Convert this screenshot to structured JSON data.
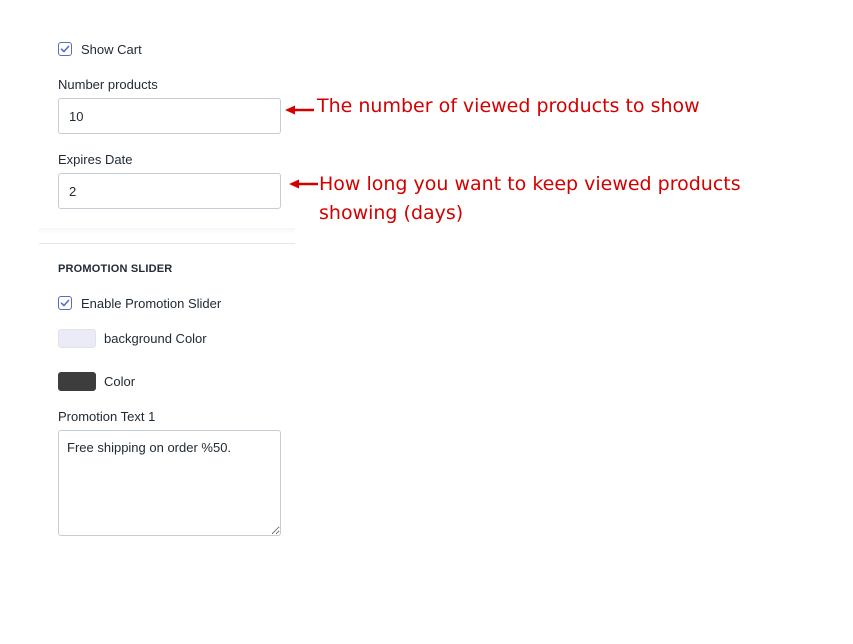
{
  "settings": {
    "show_cart": {
      "label": "Show Cart",
      "checked": true
    },
    "number_products": {
      "label": "Number products",
      "value": "10"
    },
    "expires_date": {
      "label": "Expires Date",
      "value": "2"
    }
  },
  "promotion": {
    "heading": "PROMOTION SLIDER",
    "enable": {
      "label": "Enable Promotion Slider",
      "checked": true
    },
    "background_color": {
      "label": "background Color",
      "color": "#ebeaf7"
    },
    "color": {
      "label": "Color",
      "color": "#3d3d3d"
    },
    "text1": {
      "label": "Promotion Text 1",
      "value": "Free shipping on order %50."
    }
  },
  "annotations": {
    "number_products_note": "The number of viewed products to show",
    "expires_line1": "How long you want to keep viewed products",
    "expires_line2": "showing (days)",
    "color": "#d40000"
  },
  "colors": {
    "checkbox_accent": "#5c6ac4",
    "input_border": "#c4cdd5"
  }
}
